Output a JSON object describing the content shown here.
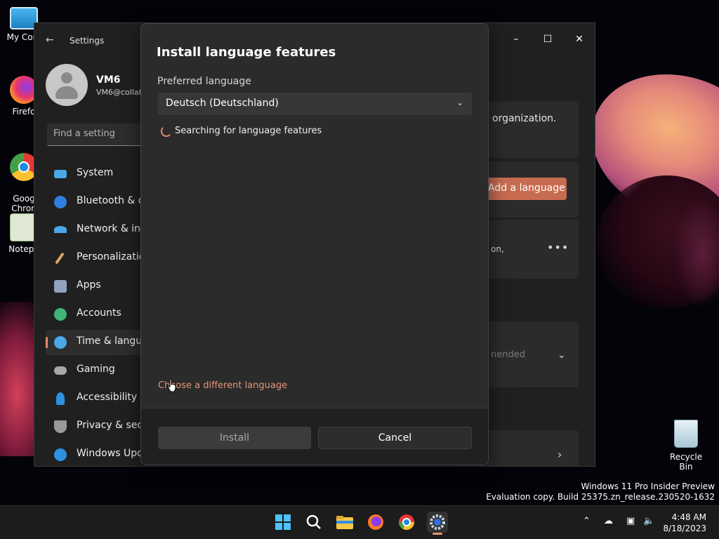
{
  "desktop": {
    "icons": [
      {
        "label": "My Com"
      },
      {
        "label": "Firefo"
      },
      {
        "label": "Goog\nChron"
      },
      {
        "label": "Notepa"
      }
    ],
    "recycle_bin": "Recycle Bin",
    "watermark": {
      "line1": "Windows 11 Pro Insider Preview",
      "line2": "Evaluation copy. Build 25375.zn_release.230520-1632"
    }
  },
  "settings": {
    "title": "Settings",
    "user": {
      "name": "VM6",
      "email": "VM6@collab"
    },
    "search_placeholder": "Find a setting",
    "nav": [
      {
        "label": "System",
        "icon": "system-icon"
      },
      {
        "label": "Bluetooth & de",
        "icon": "bluetooth-icon"
      },
      {
        "label": "Network & inte",
        "icon": "network-icon"
      },
      {
        "label": "Personalization",
        "icon": "personalization-icon"
      },
      {
        "label": "Apps",
        "icon": "apps-icon"
      },
      {
        "label": "Accounts",
        "icon": "accounts-icon"
      },
      {
        "label": "Time & langua",
        "icon": "time-language-icon"
      },
      {
        "label": "Gaming",
        "icon": "gaming-icon"
      },
      {
        "label": "Accessibility",
        "icon": "accessibility-icon"
      },
      {
        "label": "Privacy & secu",
        "icon": "privacy-icon"
      },
      {
        "label": "Windows Upda",
        "icon": "windows-update-icon"
      }
    ],
    "background": {
      "org_text": "organization.",
      "add_language": "Add a language",
      "partial_text": "on,",
      "recommended": "nended",
      "accent": "#c86c51"
    }
  },
  "dialog": {
    "title": "Install language features",
    "preferred_label": "Preferred language",
    "selected_language": "Deutsch (Deutschland)",
    "status": "Searching for language features",
    "choose_link": "Choose a different language",
    "install": "Install",
    "cancel": "Cancel"
  },
  "taskbar": {
    "time": "4:48 AM",
    "date": "8/18/2023"
  }
}
